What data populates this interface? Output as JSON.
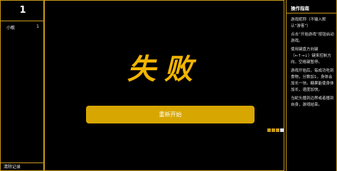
{
  "scoreboard": {
    "top_score": "1",
    "player": {
      "name": "小敏",
      "score": "1"
    },
    "clear_label": "清除记录"
  },
  "game": {
    "status_title": "失败",
    "restart_label": "重新开始"
  },
  "guide": {
    "title": "操作指南",
    "items": [
      "游戏昵称（不输入默认“游客”）",
      "点击“开始游戏”按钮启动游戏。",
      "使用键盘方向键（←↑→↓）键来控制方向。空格键暂停。",
      "游戏开始后，每成功吃到食物，分数加1，身体会加长一块。糖果能使身体加长，速度加快。",
      "当蛇头撞到边界或者撞到自身，游戏结束。"
    ]
  },
  "colors": {
    "accent": "#c89a1a",
    "title": "#f2b400",
    "button": "#d8a600",
    "background": "#000000"
  }
}
